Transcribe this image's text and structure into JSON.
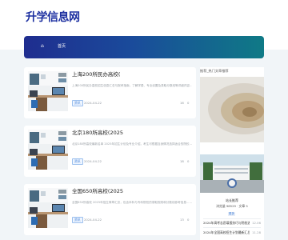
{
  "site": {
    "logo": "升学信息网"
  },
  "nav": {
    "home": "⌂",
    "item": "首页"
  },
  "cards": [
    {
      "title": "上海200所民办高校(",
      "desc": "上海200所民办高校招生信息汇总与报考指南，了解学费、专业设置及录取分数线等详细内容……",
      "tag": "资讯",
      "date": "2024-04-22",
      "views": "16",
      "comments": "0"
    },
    {
      "title": "北京180所高校(2025",
      "desc": "北京180所高校最新名单 2025年招生计划及专业介绍，考生可根据自身情况选择适合的院校……",
      "tag": "资讯",
      "date": "2024-04-22",
      "views": "18",
      "comments": "0"
    },
    {
      "title": "全国650所高校(2025",
      "desc": "全国650所高校 2025年招生简章汇总，包含本科与专科院校的录取规则和分数线参考信息……",
      "tag": "资讯",
      "date": "2024-04-22",
      "views": "13",
      "comments": "0"
    }
  ],
  "sidebar": {
    "title": "推荐_热门文章推荐",
    "author_name": "站长推荐 ",
    "author_sub": "浏览量 98529 · 文章 5",
    "more": "更多",
    "list": [
      {
        "text": "2024年高考志愿填报技巧与院校选择指南",
        "num": "12.06"
      },
      {
        "text": "2024年全国高校招生计划最新汇总发布",
        "num": "11.28"
      }
    ]
  },
  "colors": {
    "brand": "#1c2fa0",
    "nav_start": "#1f2d8f",
    "nav_end": "#0f7a86",
    "accent": "#3a7bd5"
  }
}
